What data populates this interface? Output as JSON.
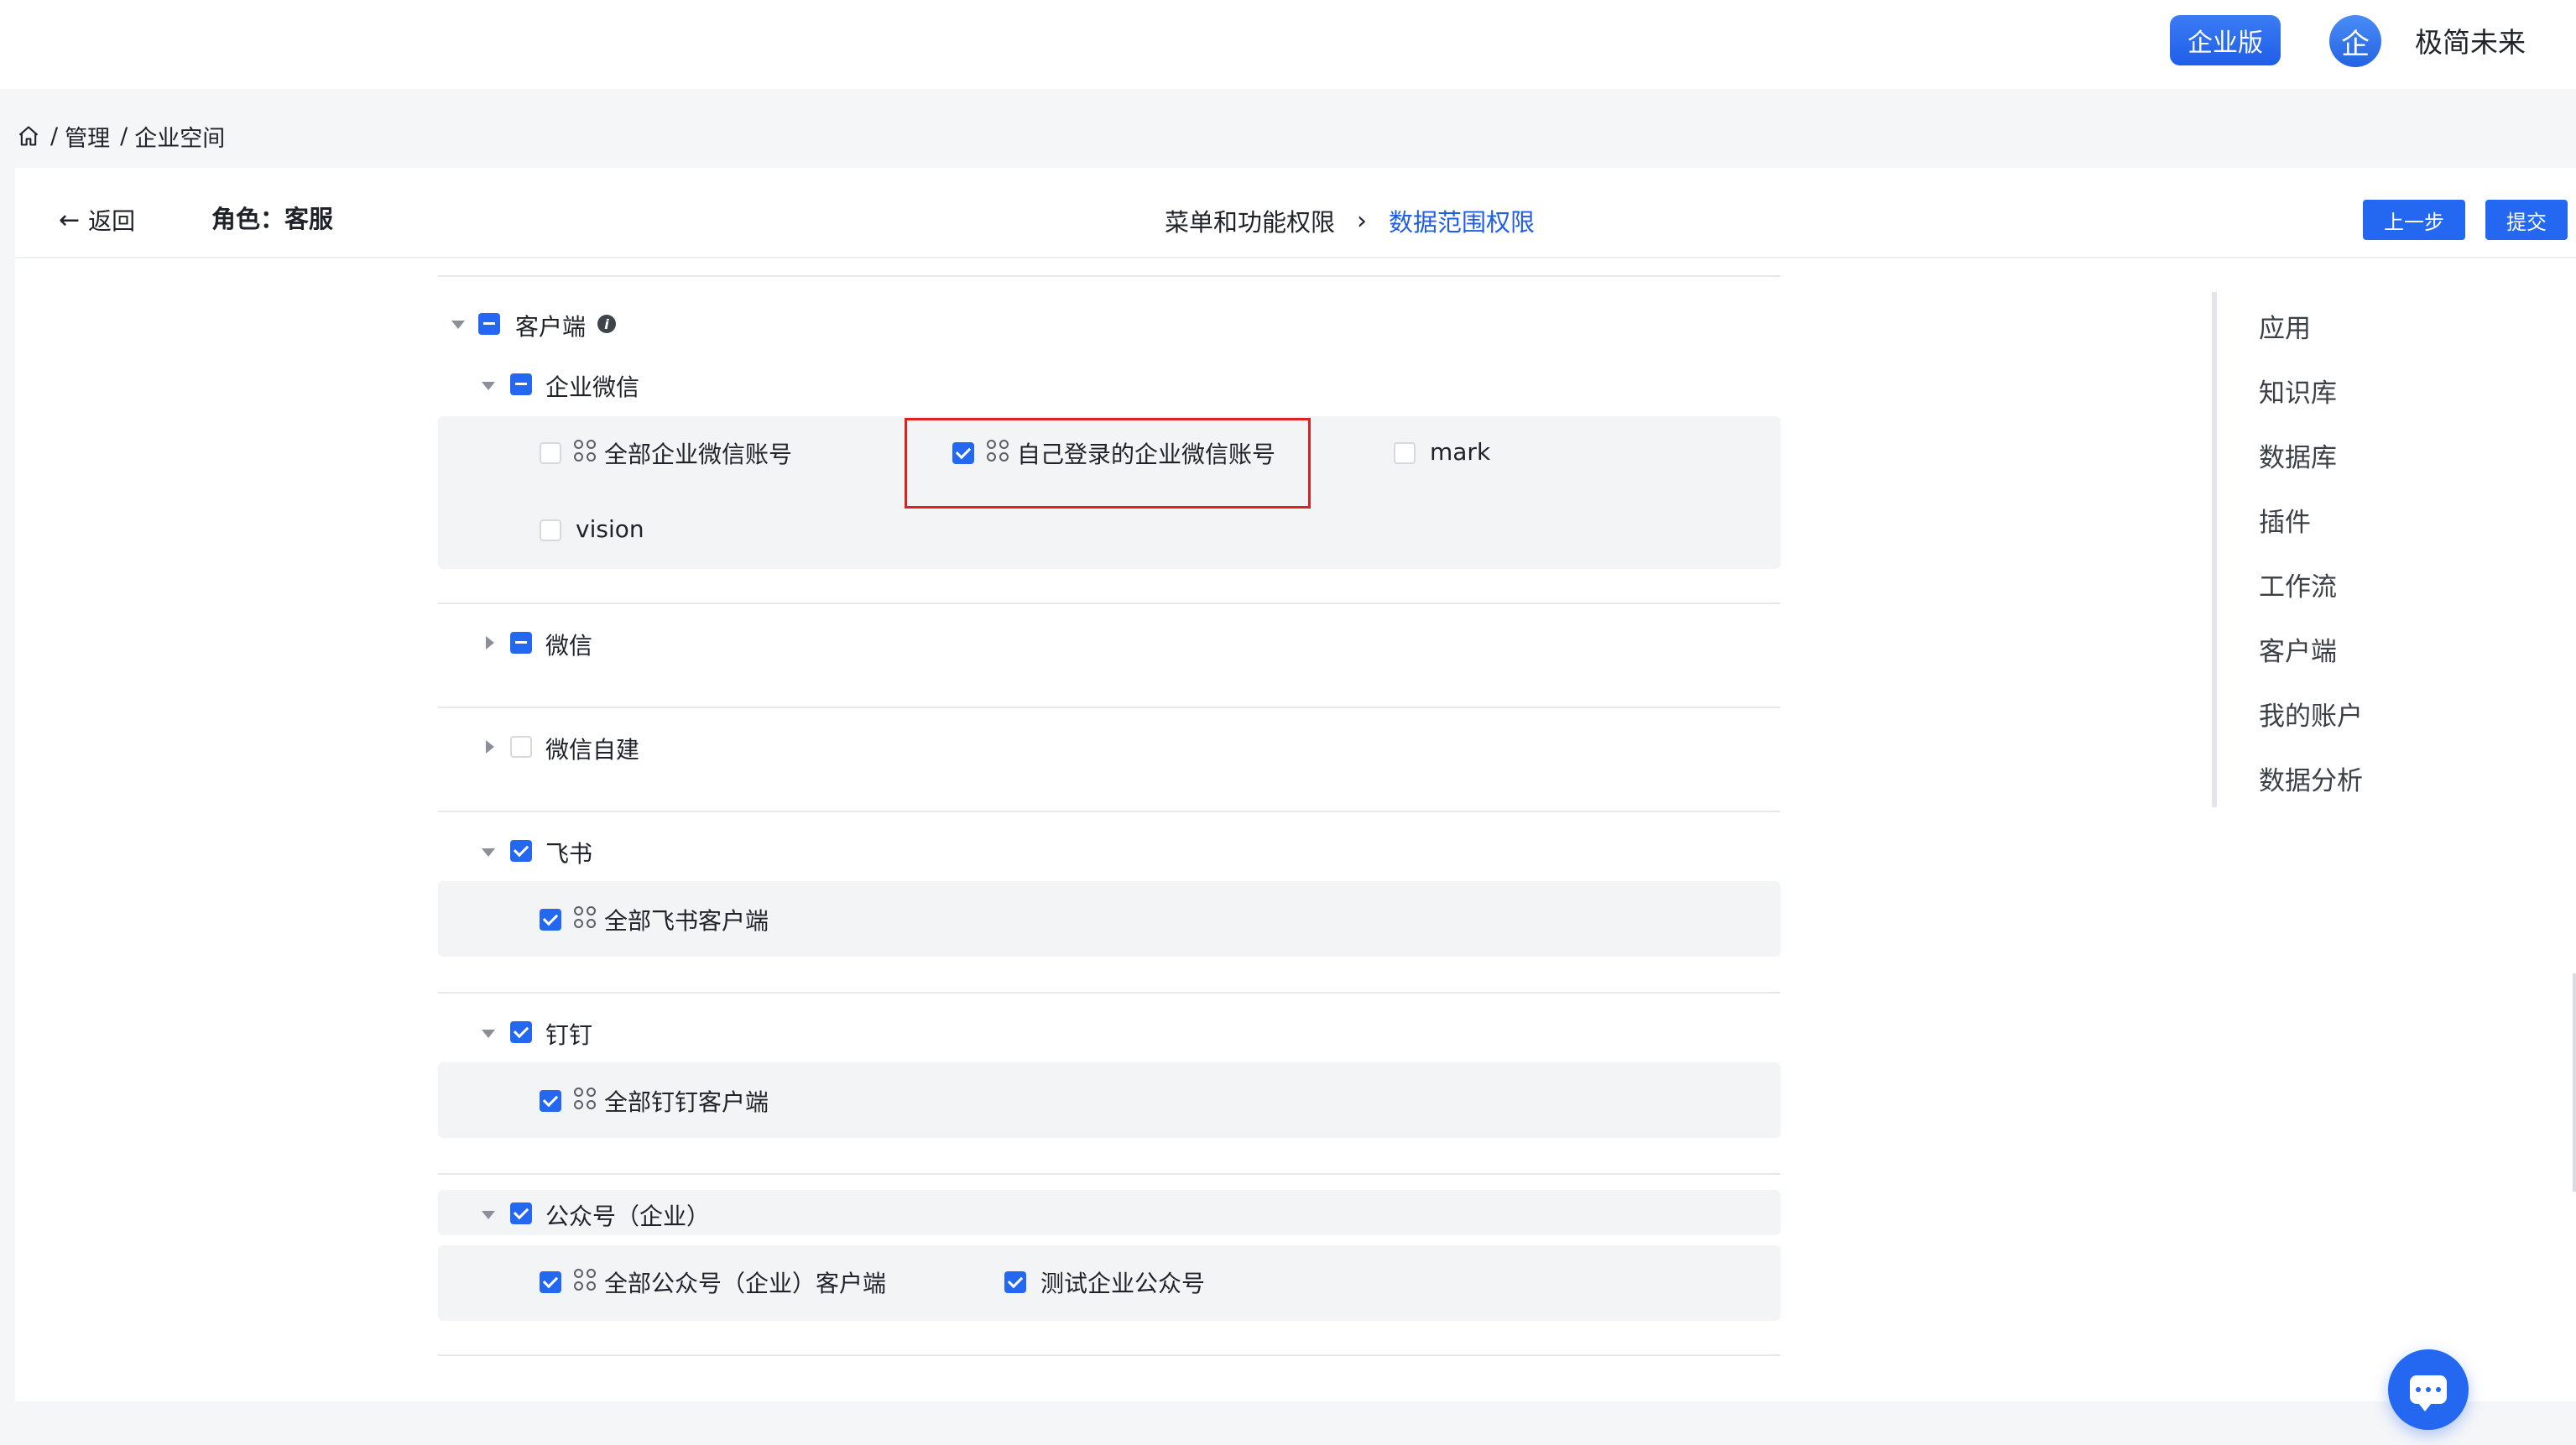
{
  "header": {
    "edition_label": "企业版",
    "avatar_text": "企",
    "org_name": "极简未来"
  },
  "breadcrumb": {
    "items": [
      "管理",
      "企业空间"
    ]
  },
  "page": {
    "back_label": "返回",
    "role_label": "角色：客服",
    "steps": [
      "菜单和功能权限",
      "数据范围权限"
    ],
    "prev_button": "上一步",
    "submit_button": "提交"
  },
  "tree": {
    "root": {
      "label": "客户端",
      "state": "partial",
      "expanded": true
    },
    "groups": [
      {
        "label": "企业微信",
        "state": "partial",
        "expanded": true,
        "options": [
          {
            "label": "全部企业微信账号",
            "checked": false,
            "grid_icon": true
          },
          {
            "label": "自己登录的企业微信账号",
            "checked": true,
            "grid_icon": true,
            "highlighted": true
          },
          {
            "label": "mark",
            "checked": false,
            "grid_icon": false
          },
          {
            "label": "vision",
            "checked": false,
            "grid_icon": false
          }
        ]
      },
      {
        "label": "微信",
        "state": "partial",
        "expanded": false
      },
      {
        "label": "微信自建",
        "state": "empty",
        "expanded": false
      },
      {
        "label": "飞书",
        "state": "checked",
        "expanded": true,
        "options": [
          {
            "label": "全部飞书客户端",
            "checked": true,
            "grid_icon": true
          }
        ]
      },
      {
        "label": "钉钉",
        "state": "checked",
        "expanded": true,
        "options": [
          {
            "label": "全部钉钉客户端",
            "checked": true,
            "grid_icon": true
          }
        ]
      },
      {
        "label": "公众号（企业）",
        "state": "checked",
        "expanded": true,
        "options": [
          {
            "label": "全部公众号（企业）客户端",
            "checked": true,
            "grid_icon": true
          },
          {
            "label": "测试企业公众号",
            "checked": true,
            "grid_icon": false
          }
        ]
      }
    ]
  },
  "side_nav": {
    "items": [
      "应用",
      "知识库",
      "数据库",
      "插件",
      "工作流",
      "客户端",
      "我的账户",
      "数据分析"
    ]
  },
  "colors": {
    "accent": "#2468f2",
    "highlight_border": "#e02020"
  },
  "icons": {
    "home": "home-icon",
    "back": "arrow-left-icon",
    "step_arrow": "chevron-right-icon",
    "info": "info-icon",
    "option": "grid-apps-icon",
    "chat": "chat-icon"
  }
}
